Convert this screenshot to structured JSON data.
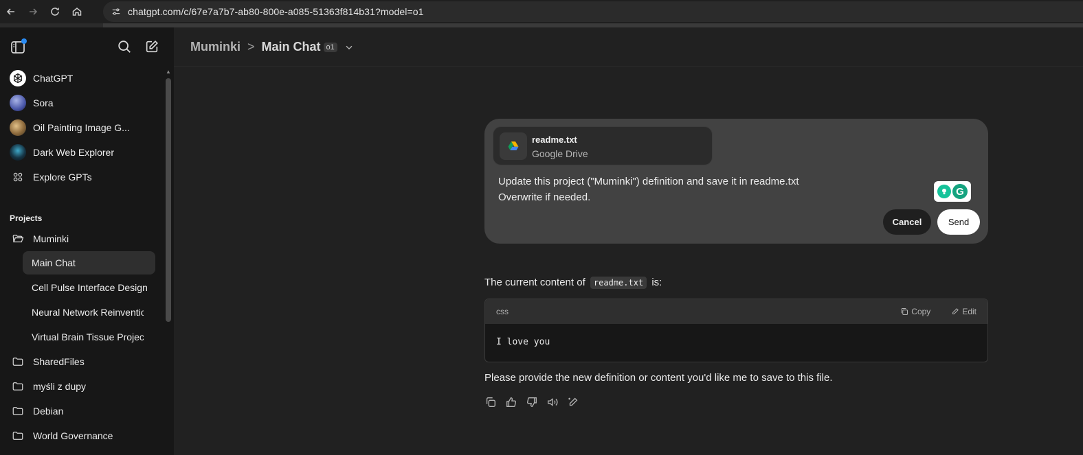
{
  "browser": {
    "url": "chatgpt.com/c/67e7a7b7-ab80-800e-a085-51363f814b31?model=o1"
  },
  "sidebar": {
    "gpts": [
      {
        "label": "ChatGPT",
        "icon": "chatgpt-logo-icon"
      },
      {
        "label": "Sora",
        "icon": "sora-avatar"
      },
      {
        "label": "Oil Painting Image G...",
        "icon": "oil-painting-avatar"
      },
      {
        "label": "Dark Web Explorer",
        "icon": "dark-web-avatar"
      },
      {
        "label": "Explore GPTs",
        "icon": "grid-icon"
      }
    ],
    "projects_heading": "Projects",
    "projects": [
      {
        "label": "Muminki",
        "icon": "folder-open-icon"
      },
      {
        "label": "Main Chat",
        "active": true
      },
      {
        "label": "Cell Pulse Interface Design"
      },
      {
        "label": "Neural Network Reinvention"
      },
      {
        "label": "Virtual Brain Tissue Project"
      },
      {
        "label": "SharedFiles",
        "icon": "folder-icon"
      },
      {
        "label": "myśli z dupy",
        "icon": "folder-icon"
      },
      {
        "label": "Debian",
        "icon": "folder-icon"
      },
      {
        "label": "World Governance",
        "icon": "folder-icon"
      }
    ]
  },
  "header": {
    "project": "Muminki",
    "separator": ">",
    "chat_title": "Main Chat",
    "model_badge": "o1"
  },
  "edit_message": {
    "file_name": "readme.txt",
    "file_source": "Google Drive",
    "line1": "Update this project (\"Muminki\") definition and save it in readme.txt",
    "line2": "Overwrite if needed.",
    "cancel_label": "Cancel",
    "send_label": "Send"
  },
  "response": {
    "intro_before": "The current content of",
    "intro_code": "readme.txt",
    "intro_after": "is:",
    "code_lang": "css",
    "copy_label": "Copy",
    "edit_label": "Edit",
    "code_content": "I love you",
    "closing": "Please provide the new definition or content you'd like me to save to this file."
  },
  "colors": {
    "background": "#212121",
    "sidebar": "#171717",
    "accent_dot": "#2a8bf2",
    "grammarly": "#15c39a"
  }
}
